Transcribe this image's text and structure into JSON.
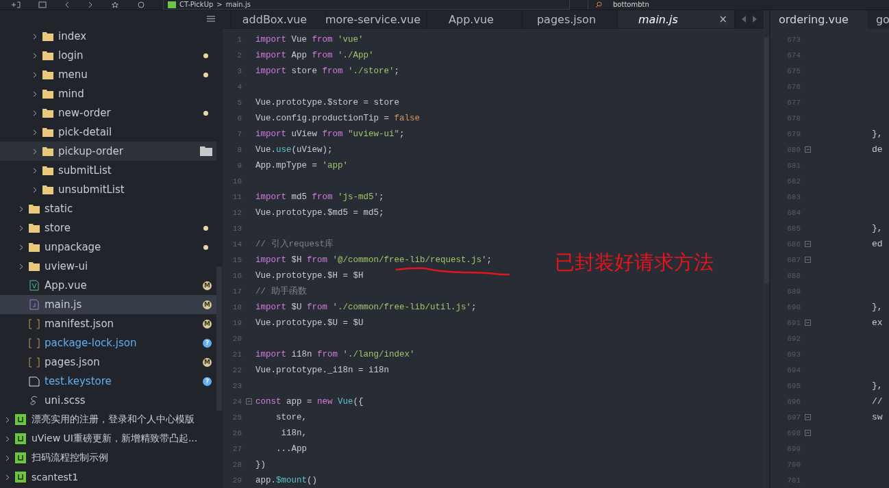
{
  "toolbar": {
    "breadcrumb": [
      "CT-PickUp",
      ">",
      "main.js"
    ],
    "search_value": "bottombtn"
  },
  "explorer": {
    "nested_items": [
      {
        "label": "index",
        "kind": "folder",
        "changed": false,
        "hovered": false,
        "selected": false
      },
      {
        "label": "login",
        "kind": "folder",
        "changed": true,
        "hovered": false,
        "selected": false
      },
      {
        "label": "menu",
        "kind": "folder",
        "changed": true,
        "hovered": false,
        "selected": false
      },
      {
        "label": "mind",
        "kind": "folder",
        "changed": false,
        "hovered": false,
        "selected": false
      },
      {
        "label": "new-order",
        "kind": "folder",
        "changed": true,
        "hovered": false,
        "selected": false
      },
      {
        "label": "pick-detail",
        "kind": "folder",
        "changed": false,
        "hovered": false,
        "selected": false
      },
      {
        "label": "pickup-order",
        "kind": "folder",
        "changed": false,
        "hovered": true,
        "selected": false
      },
      {
        "label": "submitList",
        "kind": "folder",
        "changed": false,
        "hovered": false,
        "selected": false
      },
      {
        "label": "unsubmitList",
        "kind": "folder",
        "changed": false,
        "hovered": false,
        "selected": false
      }
    ],
    "project_items": [
      {
        "label": "static",
        "kind": "folder",
        "changed": false,
        "selected": false
      },
      {
        "label": "store",
        "kind": "folder",
        "changed": true,
        "selected": false
      },
      {
        "label": "unpackage",
        "kind": "folder",
        "changed": true,
        "selected": false
      },
      {
        "label": "uview-ui",
        "kind": "folder",
        "changed": false,
        "selected": false
      },
      {
        "label": "App.vue",
        "kind": "vue",
        "badge": "M",
        "untracked": false,
        "selected": false
      },
      {
        "label": "main.js",
        "kind": "js",
        "badge": "M",
        "untracked": false,
        "selected": true
      },
      {
        "label": "manifest.json",
        "kind": "json",
        "badge": "M",
        "untracked": false,
        "selected": false
      },
      {
        "label": "package-lock.json",
        "kind": "json",
        "badge": "?",
        "untracked": true,
        "selected": false
      },
      {
        "label": "pages.json",
        "kind": "json",
        "badge": "M",
        "untracked": false,
        "selected": false
      },
      {
        "label": "test.keystore",
        "kind": "file",
        "badge": "?",
        "untracked": true,
        "selected": false
      },
      {
        "label": "uni.scss",
        "kind": "scss",
        "untracked": false,
        "selected": false
      }
    ],
    "projects": [
      {
        "label": "漂亮实用的注册，登录和个人中心模版",
        "selected": false
      },
      {
        "label": "uView UI重磅更新，新增精致带凸起...",
        "selected": false
      },
      {
        "label": "扫码流程控制示例",
        "selected": false
      },
      {
        "label": "scantest1",
        "selected": false
      }
    ]
  },
  "editor_tabs": [
    {
      "label": "addBox.vue",
      "selected": false
    },
    {
      "label": "more-service.vue",
      "selected": false
    },
    {
      "label": "App.vue",
      "selected": false
    },
    {
      "label": "pages.json",
      "selected": false
    },
    {
      "label": "main.js",
      "selected": true,
      "close": "×"
    }
  ],
  "code_lines": [
    {
      "n": "1",
      "tokens": [
        {
          "t": "import",
          "kind": "kw"
        },
        {
          "t": " Vue ",
          "kind": "plain"
        },
        {
          "t": "from",
          "kind": "kw"
        },
        {
          "t": " 'vue'",
          "kind": "str"
        }
      ]
    },
    {
      "n": "2",
      "tokens": [
        {
          "t": "import",
          "kind": "kw"
        },
        {
          "t": " App ",
          "kind": "plain"
        },
        {
          "t": "from",
          "kind": "kw"
        },
        {
          "t": " './App'",
          "kind": "str"
        }
      ]
    },
    {
      "n": "3",
      "tokens": [
        {
          "t": "import",
          "kind": "kw"
        },
        {
          "t": " store ",
          "kind": "plain"
        },
        {
          "t": "from",
          "kind": "kw"
        },
        {
          "t": " './store'",
          "kind": "str"
        },
        {
          "t": ";",
          "kind": "plain"
        }
      ]
    },
    {
      "n": "4"
    },
    {
      "n": "5",
      "tokens": [
        {
          "t": "Vue.prototype.$store = store",
          "kind": "plain"
        }
      ]
    },
    {
      "n": "6",
      "tokens": [
        {
          "t": "Vue.config.productionTip = ",
          "kind": "plain"
        },
        {
          "t": "false",
          "kind": "bool"
        }
      ]
    },
    {
      "n": "7",
      "tokens": [
        {
          "t": "import",
          "kind": "kw"
        },
        {
          "t": " uView ",
          "kind": "plain"
        },
        {
          "t": "from",
          "kind": "kw"
        },
        {
          "t": " \"uview-ui\"",
          "kind": "str"
        },
        {
          "t": ";",
          "kind": "plain"
        }
      ]
    },
    {
      "n": "8",
      "tokens": [
        {
          "t": "Vue.",
          "kind": "plain"
        },
        {
          "t": "use",
          "kind": "fn"
        },
        {
          "t": "(uView);",
          "kind": "plain"
        }
      ]
    },
    {
      "n": "9",
      "tokens": [
        {
          "t": "App.mpType = ",
          "kind": "plain"
        },
        {
          "t": "'app'",
          "kind": "str"
        }
      ]
    },
    {
      "n": "10"
    },
    {
      "n": "11",
      "tokens": [
        {
          "t": "import",
          "kind": "kw"
        },
        {
          "t": " md5 ",
          "kind": "plain"
        },
        {
          "t": "from",
          "kind": "kw"
        },
        {
          "t": " 'js-md5'",
          "kind": "str"
        },
        {
          "t": ";",
          "kind": "plain"
        }
      ]
    },
    {
      "n": "12",
      "tokens": [
        {
          "t": "Vue.prototype.$md5 = md5;",
          "kind": "plain"
        }
      ]
    },
    {
      "n": "13"
    },
    {
      "n": "14",
      "tokens": [
        {
          "t": "// 引入request库",
          "kind": "cm"
        }
      ]
    },
    {
      "n": "15",
      "tokens": [
        {
          "t": "import",
          "kind": "kw"
        },
        {
          "t": " $H ",
          "kind": "plain"
        },
        {
          "t": "from",
          "kind": "kw"
        },
        {
          "t": " '@/common/free-lib/request.js'",
          "kind": "str"
        },
        {
          "t": ";",
          "kind": "plain"
        }
      ]
    },
    {
      "n": "16",
      "tokens": [
        {
          "t": "Vue.prototype.$H = $H",
          "kind": "plain"
        }
      ]
    },
    {
      "n": "17",
      "tokens": [
        {
          "t": "// 助手函数",
          "kind": "cm"
        }
      ]
    },
    {
      "n": "18",
      "tokens": [
        {
          "t": "import",
          "kind": "kw"
        },
        {
          "t": " $U ",
          "kind": "plain"
        },
        {
          "t": "from",
          "kind": "kw"
        },
        {
          "t": " './common/free-lib/util.js'",
          "kind": "str"
        },
        {
          "t": ";",
          "kind": "plain"
        }
      ]
    },
    {
      "n": "19",
      "tokens": [
        {
          "t": "Vue.prototype.$U = $U",
          "kind": "plain"
        }
      ]
    },
    {
      "n": "20"
    },
    {
      "n": "21",
      "tokens": [
        {
          "t": "import",
          "kind": "kw"
        },
        {
          "t": " i18n ",
          "kind": "plain"
        },
        {
          "t": "from",
          "kind": "kw"
        },
        {
          "t": " './lang/index'",
          "kind": "str"
        }
      ]
    },
    {
      "n": "22",
      "tokens": [
        {
          "t": "Vue.prototype._i18n = i18n",
          "kind": "plain"
        }
      ]
    },
    {
      "n": "23"
    },
    {
      "n": "24",
      "fold": true,
      "tokens": [
        {
          "t": "const",
          "kind": "kw"
        },
        {
          "t": " app = ",
          "kind": "plain"
        },
        {
          "t": "new",
          "kind": "kw"
        },
        {
          "t": " Vue",
          "kind": "fn"
        },
        {
          "t": "({",
          "kind": "plain"
        }
      ]
    },
    {
      "n": "25",
      "tokens": [
        {
          "t": "    store,",
          "kind": "plain"
        }
      ]
    },
    {
      "n": "26",
      "tokens": [
        {
          "t": "     i18n,",
          "kind": "plain"
        }
      ]
    },
    {
      "n": "27",
      "tokens": [
        {
          "t": "    ...App",
          "kind": "plain"
        }
      ]
    },
    {
      "n": "28",
      "tokens": [
        {
          "t": "})",
          "kind": "plain"
        }
      ]
    },
    {
      "n": "29",
      "tokens": [
        {
          "t": "app.",
          "kind": "plain"
        },
        {
          "t": "$mount",
          "kind": "fn"
        },
        {
          "t": "()",
          "kind": "plain"
        }
      ]
    }
  ],
  "annotation": {
    "text": "已封装好请求方法"
  },
  "side_tabs": [
    {
      "label": "ordering.vue",
      "selected": true
    },
    {
      "label": "go",
      "selected": false
    }
  ],
  "side_lines": [
    {
      "n": "673",
      "fold": false
    },
    {
      "n": "674",
      "fold": false
    },
    {
      "n": "675",
      "fold": false
    },
    {
      "n": "676",
      "fold": false
    },
    {
      "n": "677",
      "fold": false
    },
    {
      "n": "678",
      "fold": false
    },
    {
      "n": "679",
      "fold": false,
      "code": "},"
    },
    {
      "n": "680",
      "fold": true,
      "code": "de"
    },
    {
      "n": "681",
      "fold": false
    },
    {
      "n": "682",
      "fold": false
    },
    {
      "n": "683",
      "fold": false
    },
    {
      "n": "684",
      "fold": false
    },
    {
      "n": "685",
      "fold": false,
      "code": "},"
    },
    {
      "n": "686",
      "fold": true,
      "code": "ed"
    },
    {
      "n": "687",
      "fold": true
    },
    {
      "n": "688",
      "fold": false
    },
    {
      "n": "689",
      "fold": false
    },
    {
      "n": "690",
      "fold": false,
      "code": "},"
    },
    {
      "n": "691",
      "fold": true,
      "code": "ex"
    },
    {
      "n": "692",
      "fold": false
    },
    {
      "n": "693",
      "fold": false
    },
    {
      "n": "694",
      "fold": false
    },
    {
      "n": "695",
      "fold": false,
      "code": "},"
    },
    {
      "n": "696",
      "fold": false,
      "code": "//"
    },
    {
      "n": "697",
      "fold": true,
      "code": "sw"
    },
    {
      "n": "698",
      "fold": true
    },
    {
      "n": "699",
      "fold": false
    },
    {
      "n": "700",
      "fold": false
    },
    {
      "n": "701",
      "fold": false
    }
  ]
}
